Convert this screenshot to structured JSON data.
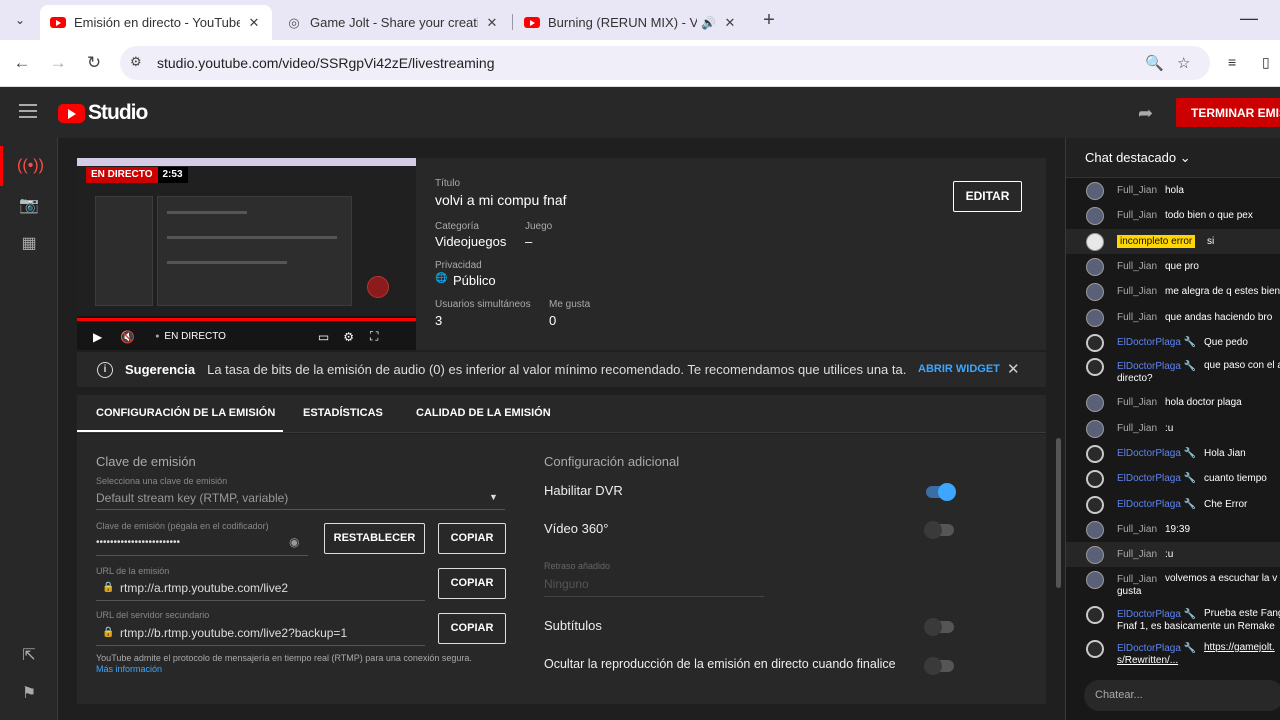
{
  "browser": {
    "tabs": [
      {
        "title": "Emisión en directo - YouTube Studio",
        "active": true
      },
      {
        "title": "Game Jolt - Share your creations",
        "active": false
      },
      {
        "title": "Burning (RERUN MIX) - Vs. ",
        "active": false
      }
    ],
    "url": "studio.youtube.com/video/SSRgpVi42zE/livestreaming"
  },
  "header": {
    "logo_text": "Studio",
    "end_button": "TERMINAR EMISIÓN"
  },
  "preview": {
    "live_badge": "EN DIRECTO",
    "time": "2:53",
    "live_label": "EN DIRECTO",
    "progress": 1.0
  },
  "info": {
    "title_label": "Título",
    "title": "volvi a mi compu fnaf",
    "category_label": "Categoría",
    "category": "Videojuegos",
    "game_label": "Juego",
    "game": "–",
    "privacy_label": "Privacidad",
    "privacy": "Público",
    "viewers_label": "Usuarios simultáneos",
    "viewers": "3",
    "likes_label": "Me gusta",
    "likes": "0",
    "edit_button": "EDITAR"
  },
  "suggestion": {
    "title": "Sugerencia",
    "text": "La tasa de bits de la emisión de audio (0) es inferior al valor mínimo recomendado. Te recomendamos que utilices una ta...",
    "link": "ABRIR WIDGET"
  },
  "tabs": [
    "CONFIGURACIÓN DE LA EMISIÓN",
    "ESTADÍSTICAS",
    "CALIDAD DE LA EMISIÓN"
  ],
  "stream_key": {
    "section_title": "Clave de emisión",
    "select_label": "Selecciona una clave de emisión",
    "select_value": "Default stream key (RTMP, variable)",
    "key_label": "Clave de emisión (pégala en el codificador)",
    "key_value": "••••••••••••••••••••••••",
    "reset_button": "RESTABLECER",
    "copy_button": "COPIAR",
    "url_label": "URL de la emisión",
    "url_value": "rtmp://a.rtmp.youtube.com/live2",
    "backup_label": "URL del servidor secundario",
    "backup_value": "rtmp://b.rtmp.youtube.com/live2?backup=1",
    "footer_text": "YouTube admite el protocolo de mensajería en tiempo real (RTMP) para una conexión segura.",
    "footer_link": "Más información"
  },
  "additional": {
    "section_title": "Configuración adicional",
    "dvr_label": "Habilitar DVR",
    "dvr_on": true,
    "video360_label": "Vídeo 360°",
    "video360_on": false,
    "delay_label": "Retraso añadido",
    "delay_value": "Ninguno",
    "subtitles_label": "Subtítulos",
    "subtitles_on": false,
    "hide_label": "Ocultar la reproducción de la emisión en directo cuando finalice",
    "hide_on": false
  },
  "chat": {
    "title": "Chat destacado",
    "input_placeholder": "Chatear...",
    "messages": [
      {
        "author": "Full_Jian",
        "text": "hola"
      },
      {
        "author": "Full_Jian",
        "text": "todo bien o que pex"
      },
      {
        "author": "incompleto error",
        "text": "si"
      },
      {
        "author": "Full_Jian",
        "text": "que pro"
      },
      {
        "author": "Full_Jian",
        "text": "me alegra de q estes bien"
      },
      {
        "author": "Full_Jian",
        "text": "que andas haciendo bro"
      },
      {
        "author": "ElDoctorPlaga 🔧",
        "text": "Que pedo"
      },
      {
        "author": "ElDoctorPlaga 🔧",
        "text": "que paso con el a directo?"
      },
      {
        "author": "Full_Jian",
        "text": "hola doctor plaga"
      },
      {
        "author": "Full_Jian",
        "text": ":u"
      },
      {
        "author": "ElDoctorPlaga 🔧",
        "text": "Hola Jian"
      },
      {
        "author": "ElDoctorPlaga 🔧",
        "text": "cuanto tiempo"
      },
      {
        "author": "ElDoctorPlaga 🔧",
        "text": "Che Error"
      },
      {
        "author": "Full_Jian",
        "text": "19:39"
      },
      {
        "author": "Full_Jian",
        "text": ":u"
      },
      {
        "author": "Full_Jian",
        "text": "volvemos a escuchar la v gusta"
      },
      {
        "author": "ElDoctorPlaga 🔧",
        "text": "Prueba este Fang Fnaf 1, es basicamente un Remake"
      },
      {
        "author": "ElDoctorPlaga 🔧",
        "text": "https://gamejolt. s/Rewritten/..."
      }
    ]
  }
}
